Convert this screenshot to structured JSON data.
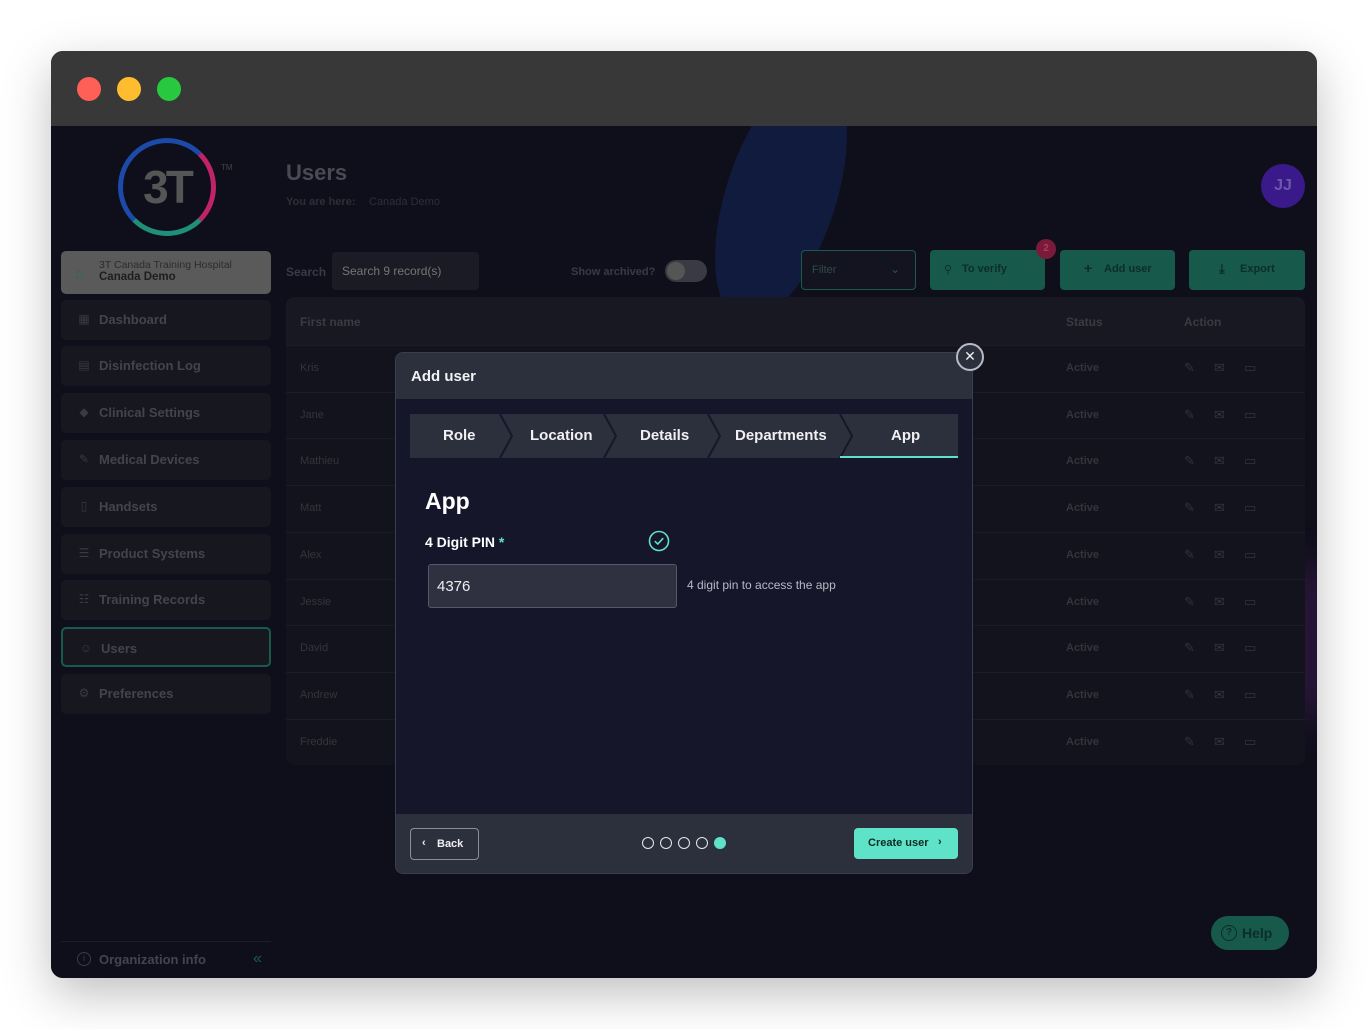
{
  "sidebar": {
    "logo_text": "3T",
    "logo_tm": "TM",
    "org_line1": "3T Canada Training Hospital",
    "org_line2": "Canada Demo",
    "items": [
      {
        "label": "Dashboard",
        "icon": "grid-icon"
      },
      {
        "label": "Disinfection Log",
        "icon": "document-icon"
      },
      {
        "label": "Clinical Settings",
        "icon": "diamond-icon"
      },
      {
        "label": "Medical Devices",
        "icon": "pen-icon"
      },
      {
        "label": "Handsets",
        "icon": "phone-icon"
      },
      {
        "label": "Product Systems",
        "icon": "list-icon"
      },
      {
        "label": "Training Records",
        "icon": "checklist-icon"
      },
      {
        "label": "Users",
        "icon": "users-icon"
      },
      {
        "label": "Preferences",
        "icon": "gear-icon"
      }
    ],
    "active_item": "Users",
    "org_info_label": "Organization info"
  },
  "header": {
    "title": "Users",
    "breadcrumb_label": "You are here:",
    "breadcrumb_value": "Canada Demo",
    "avatar_initials": "JJ"
  },
  "toolbar": {
    "search_label": "Search",
    "search_placeholder": "Search 9 record(s)",
    "show_archived_label": "Show archived?",
    "filter_placeholder": "Filter",
    "verify_label": "To verify",
    "verify_count": "2",
    "add_user_label": "Add user",
    "export_label": "Export"
  },
  "table": {
    "columns": {
      "first_name": "First name",
      "status": "Status",
      "action": "Action"
    },
    "rows": [
      {
        "first_name": "Kris",
        "status": "Active"
      },
      {
        "first_name": "Jane",
        "status": "Active"
      },
      {
        "first_name": "Mathieu",
        "status": "Active"
      },
      {
        "first_name": "Matt",
        "status": "Active"
      },
      {
        "first_name": "Alex",
        "status": "Active"
      },
      {
        "first_name": "Jessie",
        "status": "Active"
      },
      {
        "first_name": "David",
        "status": "Active"
      },
      {
        "first_name": "Andrew",
        "status": "Active"
      },
      {
        "first_name": "Freddie",
        "status": "Active"
      }
    ]
  },
  "help_label": "Help",
  "modal": {
    "title": "Add user",
    "steps": [
      "Role",
      "Location",
      "Details",
      "Departments",
      "App"
    ],
    "active_step": "App",
    "section_title": "App",
    "pin_label": "4 Digit PIN",
    "required_mark": "*",
    "pin_value": "4376",
    "pin_hint": "4 digit pin to access the app",
    "back_label": "Back",
    "create_label": "Create user",
    "progress_current": 5,
    "progress_total": 5
  },
  "colors": {
    "accent": "#5ee3c8",
    "modal_bg": "#151629",
    "panel_bg": "#2c303d"
  }
}
